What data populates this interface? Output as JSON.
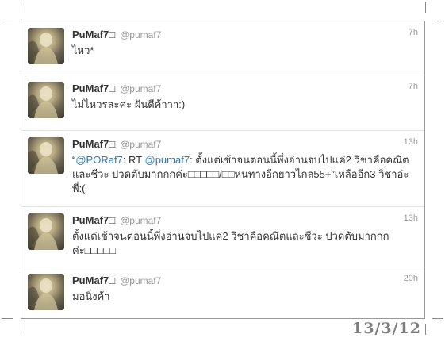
{
  "tweets": [
    {
      "name": "PuMaf7□",
      "handle": "@pumaf7",
      "time": "7h",
      "text": "ไหว*"
    },
    {
      "name": "PuMaf7□",
      "handle": "@pumaf7",
      "time": "7h",
      "text": "ไม่ไหวรละค่ะ ฝันดีค้าาา:)"
    },
    {
      "name": "PuMaf7□",
      "handle": "@pumaf7",
      "time": "13h",
      "text_quote_open": "“",
      "mention1": "@PORaf7",
      "text_mid": ": RT ",
      "mention2": "@pumaf7",
      "text_rest": ": ตั้งแต่เช้าจนตอนนี้พึ่งอ่านจบไปแค่2 วิชาคือคณิตและชีวะ ปวดตับมากกกค่ะ□□□□□/□□หนทางอีกยาวไกล55+”เหลืออีก3 วิชาอ่ะพี่:("
    },
    {
      "name": "PuMaf7□",
      "handle": "@pumaf7",
      "time": "13h",
      "text": "ตั้งแต่เช้าจนตอนนี้พึ่งอ่านจบไปแค่2 วิชาคือคณิตและชีวะ ปวดตับมากกกค่ะ□□□□□"
    },
    {
      "name": "PuMaf7□",
      "handle": "@pumaf7",
      "time": "20h",
      "text": "มอนิ่งค้า"
    }
  ],
  "stamp": "13/3/12",
  "colors": {
    "mention": "#2b7bb9",
    "name": "#333333",
    "meta": "#999999"
  }
}
